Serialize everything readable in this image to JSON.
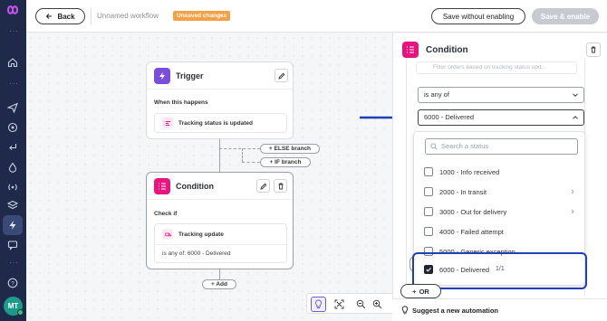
{
  "topbar": {
    "back_label": "Back",
    "workflow_name": "Unnamed workflow",
    "status_badge": "Unsaved changes",
    "save_without_enabling": "Save without enabling",
    "save_and_enable": "Save & enable"
  },
  "sidebar": {
    "avatar_initials": "MT",
    "icons": [
      "home-icon",
      "send-icon",
      "location-icon",
      "return-icon",
      "drop-icon",
      "broadcast-icon",
      "layers-icon",
      "lightning-icon",
      "chat-icon",
      "help-icon"
    ]
  },
  "canvas": {
    "trigger": {
      "title": "Trigger",
      "when_label": "When this happens",
      "event": "Tracking status is updated"
    },
    "else_branch": "+ ELSE branch",
    "if_branch": "+ IF branch",
    "condition": {
      "title": "Condition",
      "check_label": "Check if",
      "check_item": "Tracking update",
      "check_value": "is any of: 6000 - Delivered"
    },
    "add_label": "+ Add"
  },
  "panel": {
    "title": "Condition",
    "description_placeholder": "Filter orders based on tracking status upd...",
    "operator": "is any of",
    "selected_value": "6000 - Delivered",
    "search_placeholder": "Search a status",
    "options": [
      {
        "label": "1000 - Info received",
        "checked": false,
        "has_children": false
      },
      {
        "label": "2000 - In transit",
        "checked": false,
        "has_children": true
      },
      {
        "label": "3000 - Out for delivery",
        "checked": false,
        "has_children": true
      },
      {
        "label": "4000 - Failed attempt",
        "checked": false,
        "has_children": false
      },
      {
        "label": "5000 - Generic exception",
        "checked": false,
        "has_children": false
      },
      {
        "label": "6000 - Delivered",
        "checked": true,
        "has_children": false,
        "count": "1/1"
      }
    ],
    "or_label": "OR",
    "suggest_label": "Suggest a new automation"
  },
  "colors": {
    "sidebar_bg": "#1f2a4a",
    "trigger_accent": "#7b4ddb",
    "condition_accent": "#e9157f",
    "badge_orange": "#f5a045",
    "highlight_blue": "#1d3fb8"
  }
}
